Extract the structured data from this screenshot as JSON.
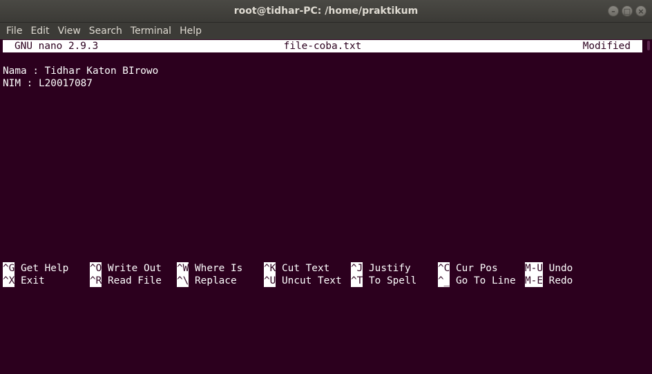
{
  "window": {
    "title": "root@tidhar-PC: /home/praktikum"
  },
  "menu": {
    "items": [
      "File",
      "Edit",
      "View",
      "Search",
      "Terminal",
      "Help"
    ]
  },
  "nano": {
    "version": "GNU nano 2.9.3",
    "filename": "file-coba.txt",
    "status": "Modified"
  },
  "content": {
    "lines": [
      "Nama : Tidhar Katon BIrowo",
      "NIM : L20017087"
    ]
  },
  "shortcuts": {
    "row1": [
      {
        "key": "^G",
        "label": " Get Help"
      },
      {
        "key": "^O",
        "label": " Write Out"
      },
      {
        "key": "^W",
        "label": " Where Is"
      },
      {
        "key": "^K",
        "label": " Cut Text"
      },
      {
        "key": "^J",
        "label": " Justify"
      },
      {
        "key": "^C",
        "label": " Cur Pos"
      },
      {
        "key": "M-U",
        "label": " Undo"
      }
    ],
    "row2": [
      {
        "key": "^X",
        "label": " Exit"
      },
      {
        "key": "^R",
        "label": " Read File"
      },
      {
        "key": "^\\",
        "label": " Replace"
      },
      {
        "key": "^U",
        "label": " Uncut Text"
      },
      {
        "key": "^T",
        "label": " To Spell"
      },
      {
        "key": "^_",
        "label": " Go To Line"
      },
      {
        "key": "M-E",
        "label": " Redo"
      }
    ]
  },
  "colors": {
    "terminal_bg": "#2c001e",
    "terminal_fg": "#ffffff",
    "titlebar_bg": "#3b3a36",
    "menubar_bg": "#3c3b37"
  }
}
